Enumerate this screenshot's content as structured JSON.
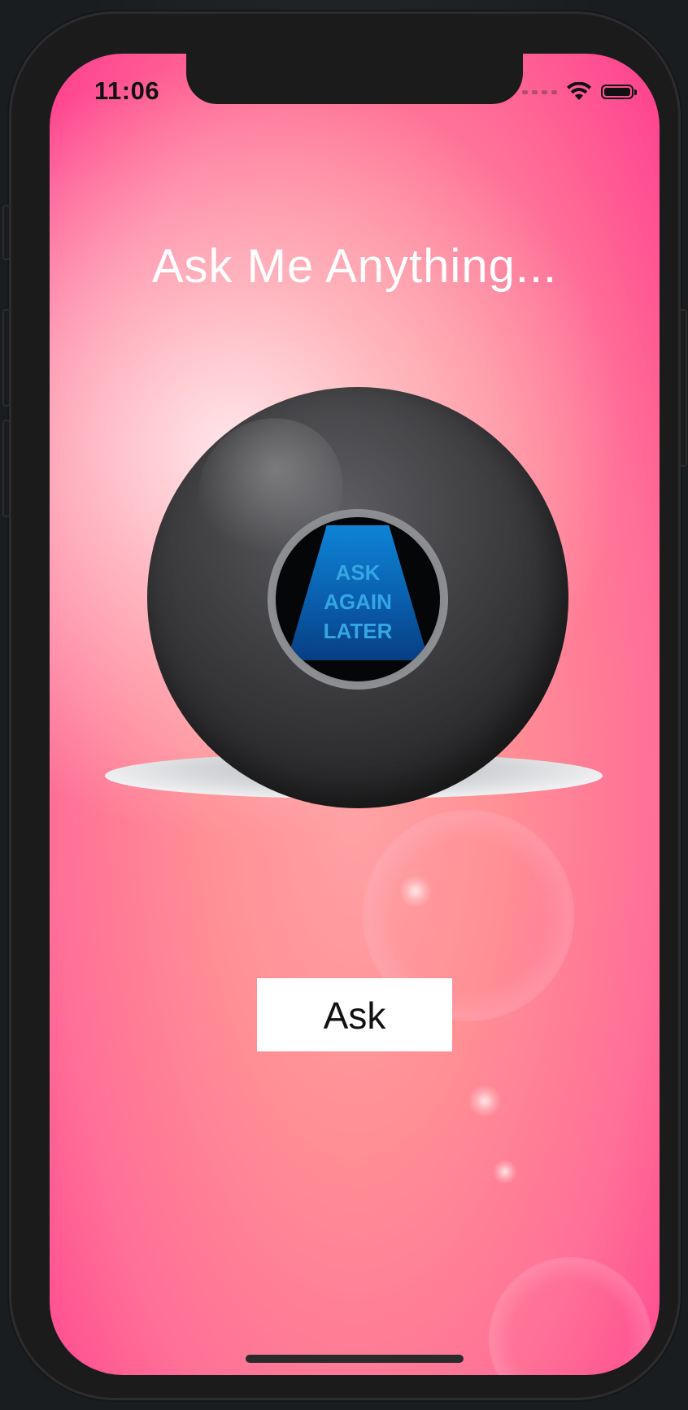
{
  "status_bar": {
    "time": "11:06",
    "icons": [
      "cellular-signal-icon",
      "wifi-icon",
      "battery-icon"
    ]
  },
  "app": {
    "title": "Ask Me Anything...",
    "eight_ball": {
      "answer_lines": [
        "ASK",
        "AGAIN",
        "LATER"
      ]
    },
    "ask_button_label": "Ask"
  },
  "colors": {
    "background_top": "#ffa3a6",
    "background_bottom": "#ff3f8e",
    "answer_text": "#34a6e4",
    "triangle": "#0a5fae",
    "button_bg": "#ffffff"
  }
}
